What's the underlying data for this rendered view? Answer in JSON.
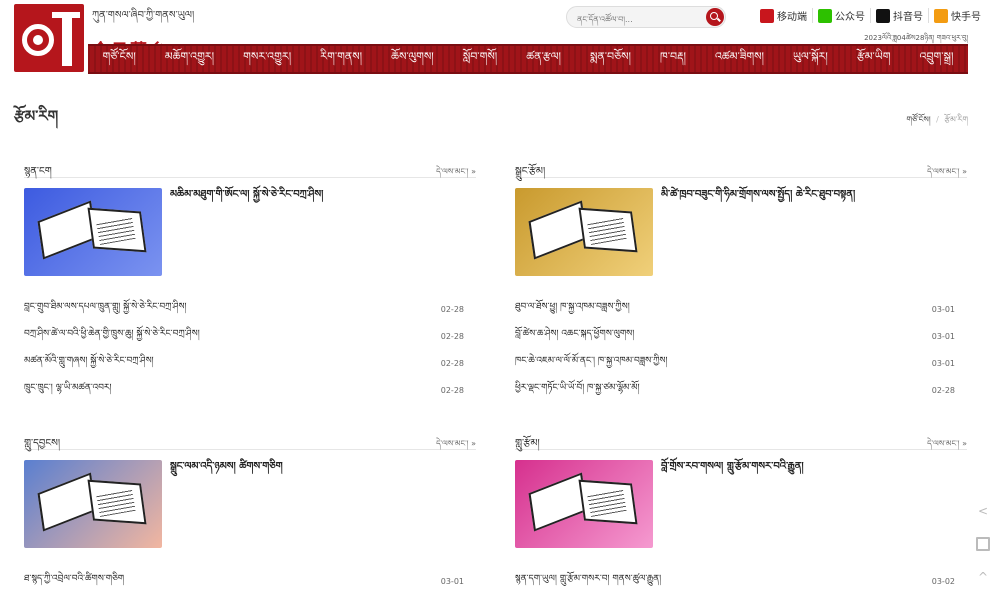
{
  "header": {
    "brand_tibetan": "ཀུན་གསལ་ཞིབ་ཀྱི་གནས་ཡུལ།",
    "brand_chinese": "今日藏乡",
    "search_placeholder": "ནང་དོན་འཚོལ་བ།...",
    "links": [
      {
        "label": "移动端",
        "icon": "mobile-icon",
        "color": "#c8161d"
      },
      {
        "label": "公众号",
        "icon": "wechat-icon",
        "color": "#2dc100"
      },
      {
        "label": "抖音号",
        "icon": "tiktok-icon",
        "color": "#111111"
      },
      {
        "label": "快手号",
        "icon": "kuaishou-icon",
        "color": "#f39c12"
      }
    ],
    "date": "2023ལོའི་ཟླ04ཚེས28ཉིན། གཟའ་ཕུར་བུ།"
  },
  "nav": [
    "གཙོ་ངོས།",
    "མཆོག་འགྱུར།",
    "གསར་འགྱུར།",
    "རིག་གནས།",
    "ཆོས་ལུགས།",
    "སློབ་གསོ།",
    "ཚན་རྩལ།",
    "སྨན་བཅོས།",
    "ཁ་བརྡ།",
    "འཚམ་ཟིགས།",
    "ཡུལ་སྐོར།",
    "རྩོམ་ཡིག",
    "འབྲུག་སྒྲ།"
  ],
  "page": {
    "title": "རྩོམ་རིག",
    "breadcrumb_home": "གཙོ་ངོས།",
    "breadcrumb_sep": "/",
    "breadcrumb_current": "རྩོམ་རིག"
  },
  "sections": [
    {
      "title": "སྙན་ངག",
      "more": "དེ་ལས་མང་། »",
      "thumb_color": "#4a63e0",
      "feature_title": "མཆིམ་མཐུག་གི་ཨོང་ལ། སྐྱོ་སེ་ཅེ་རིང་བཀྲ་ཤིས།",
      "items": [
        {
          "title": "བླང་གྲུབ་ཐིམ་ལས་དཔལ་ཁྲུན་གླུ། སྐྱོ་སེ་ཅེ་རིང་བཀྲ་ཤིས།",
          "date": "02-28"
        },
        {
          "title": "བཀྲ་ཤིས་ཚེ་ལ་བའི་ཕྱི་ཆེན་གྱི་ཁྲུས་ཆུ། སྐྱོ་སེ་ཅེ་རིང་བཀྲ་ཤིས།",
          "date": "02-28"
        },
        {
          "title": "མཚན་མོའི་གླུ་གཞས། སྐྱོ་སེ་ཅེ་རིང་བཀྲ་ཤིས།",
          "date": "02-28"
        },
        {
          "title": "ཁྲུང་ཁྲུང་། ལྷ་ཡི་མཚན་འབར།",
          "date": "02-28"
        }
      ]
    },
    {
      "title": "སྒྲུང་རྩོམ།",
      "more": "དེ་ལས་མང་། »",
      "thumb_color": "#d9a93a",
      "feature_title": "མི་ཚེ་ཁྲབ་བཟུང་གི་ཧིམ་གྲོགས་ལས་སྤྱོད། ཆེ་རིང་ཐུབ་བསྟན།",
      "items": [
        {
          "title": "ཐུབ་ལ་ཐོས་ཕྱུ། ཁ་སྐྱ་འཁམ་བཟླས་ཀྱིས།",
          "date": "03-01"
        },
        {
          "title": "བློ་ཚེས་ཆ་ཤེས། འཆང་སྐད་ཕྱོགས་ལུགས།",
          "date": "03-01"
        },
        {
          "title": "ཁང་ཆེ་འཇམ་ལ་ལོ་མོ་ནང་། ཁ་སྐྱ་འཁམ་བཟླས་ཀྱིས།",
          "date": "03-01"
        },
        {
          "title": "ཕྱིར་ལྡང་གཏོང་ཡི་ཡོ་བོ། ཁ་སྐྱ་ཙམ་ལྷོམ་མོ།",
          "date": "02-28"
        }
      ]
    },
    {
      "title": "གླུ་དབྱངས།",
      "more": "དེ་ལས་མང་། »",
      "thumb_color": "#6b8fd6",
      "feature_title": "སྒྲུང་ལམ་འདི་ཉམས། ཚིགས་གཅིག",
      "items": [
        {
          "title": "ཐ་སྙད་ཀྱི་འབྲེལ་བའི་ཚིགས་གཅིག",
          "date": "03-01"
        }
      ]
    },
    {
      "title": "གླུ་རྩོམ།",
      "more": "དེ་ལས་མང་། »",
      "thumb_color": "#e0409a",
      "feature_title": "བློ་གྲོས་རབ་གསལ། གླུ་རྩོམ་གསར་བའི་རྒྱུན།",
      "items": [
        {
          "title": "སྙན་དག་ཡུལ། གླུ་རྩོམ་གསར་བ། གནས་ཚུལ་རྒྱུན།",
          "date": "03-02"
        }
      ]
    }
  ],
  "side_tools": [
    "share-icon",
    "qrcode-icon",
    "back-to-top-icon"
  ]
}
